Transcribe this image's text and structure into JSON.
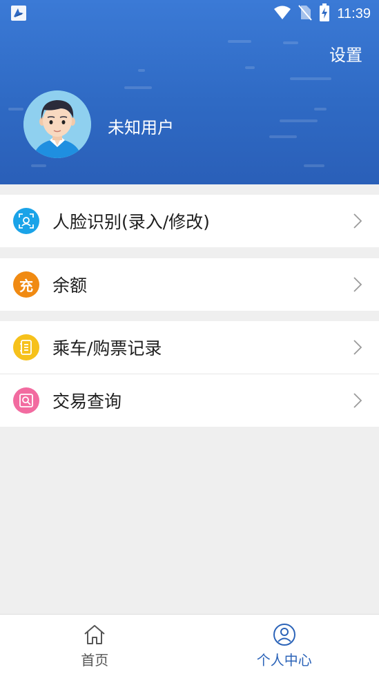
{
  "status_bar": {
    "time": "11:39"
  },
  "header": {
    "settings_label": "设置",
    "username": "未知用户"
  },
  "menu": {
    "face": {
      "label": "人脸识别(录入/修改)",
      "icon": "face-scan-icon",
      "color": "#1aa3e8"
    },
    "balance": {
      "label": "余额",
      "icon": "recharge-icon",
      "badge_text": "充",
      "color": "#f08a12"
    },
    "records": {
      "label": "乘车/购票记录",
      "icon": "ticket-record-icon",
      "color": "#f6c11b"
    },
    "transactions": {
      "label": "交易查询",
      "icon": "transaction-search-icon",
      "color": "#f26ba0"
    }
  },
  "bottom_nav": {
    "home": {
      "label": "首页",
      "icon": "home-icon",
      "active": false
    },
    "profile": {
      "label": "个人中心",
      "icon": "user-icon",
      "active": true
    }
  },
  "colors": {
    "header_blue": "#2f6ac4",
    "active_tab": "#2b63b8",
    "inactive_tab": "#555555"
  }
}
